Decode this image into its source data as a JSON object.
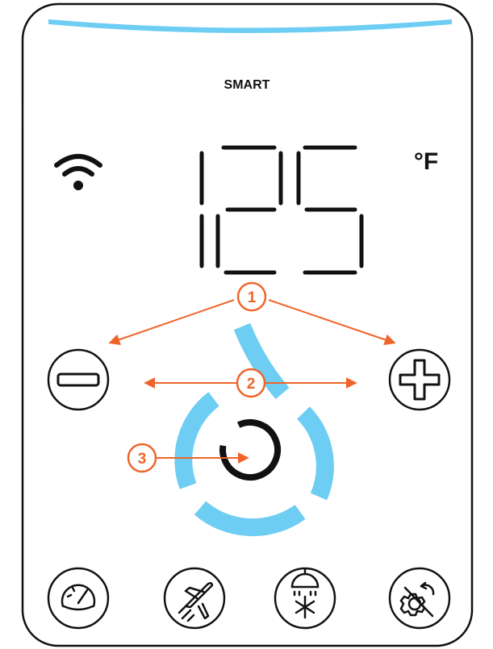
{
  "device": {
    "mode_label": "SMART",
    "temperature": "125",
    "unit": "°F"
  },
  "status": {
    "wifi_connected": true
  },
  "controls": {
    "decrease": {
      "icon": "minus-icon"
    },
    "increase": {
      "icon": "plus-icon"
    },
    "power": {
      "icon": "power-ring-icon"
    }
  },
  "callouts": [
    {
      "number": "1"
    },
    {
      "number": "2"
    },
    {
      "number": "3"
    }
  ],
  "bottom_buttons": [
    {
      "icon": "gauge-icon"
    },
    {
      "icon": "airplane-icon"
    },
    {
      "icon": "shower-snowflake-icon"
    },
    {
      "icon": "gear-reset-slash-icon"
    }
  ],
  "colors": {
    "accent_blue": "#6dcdf3",
    "callout_orange": "#f0642a",
    "ink": "#111111"
  }
}
